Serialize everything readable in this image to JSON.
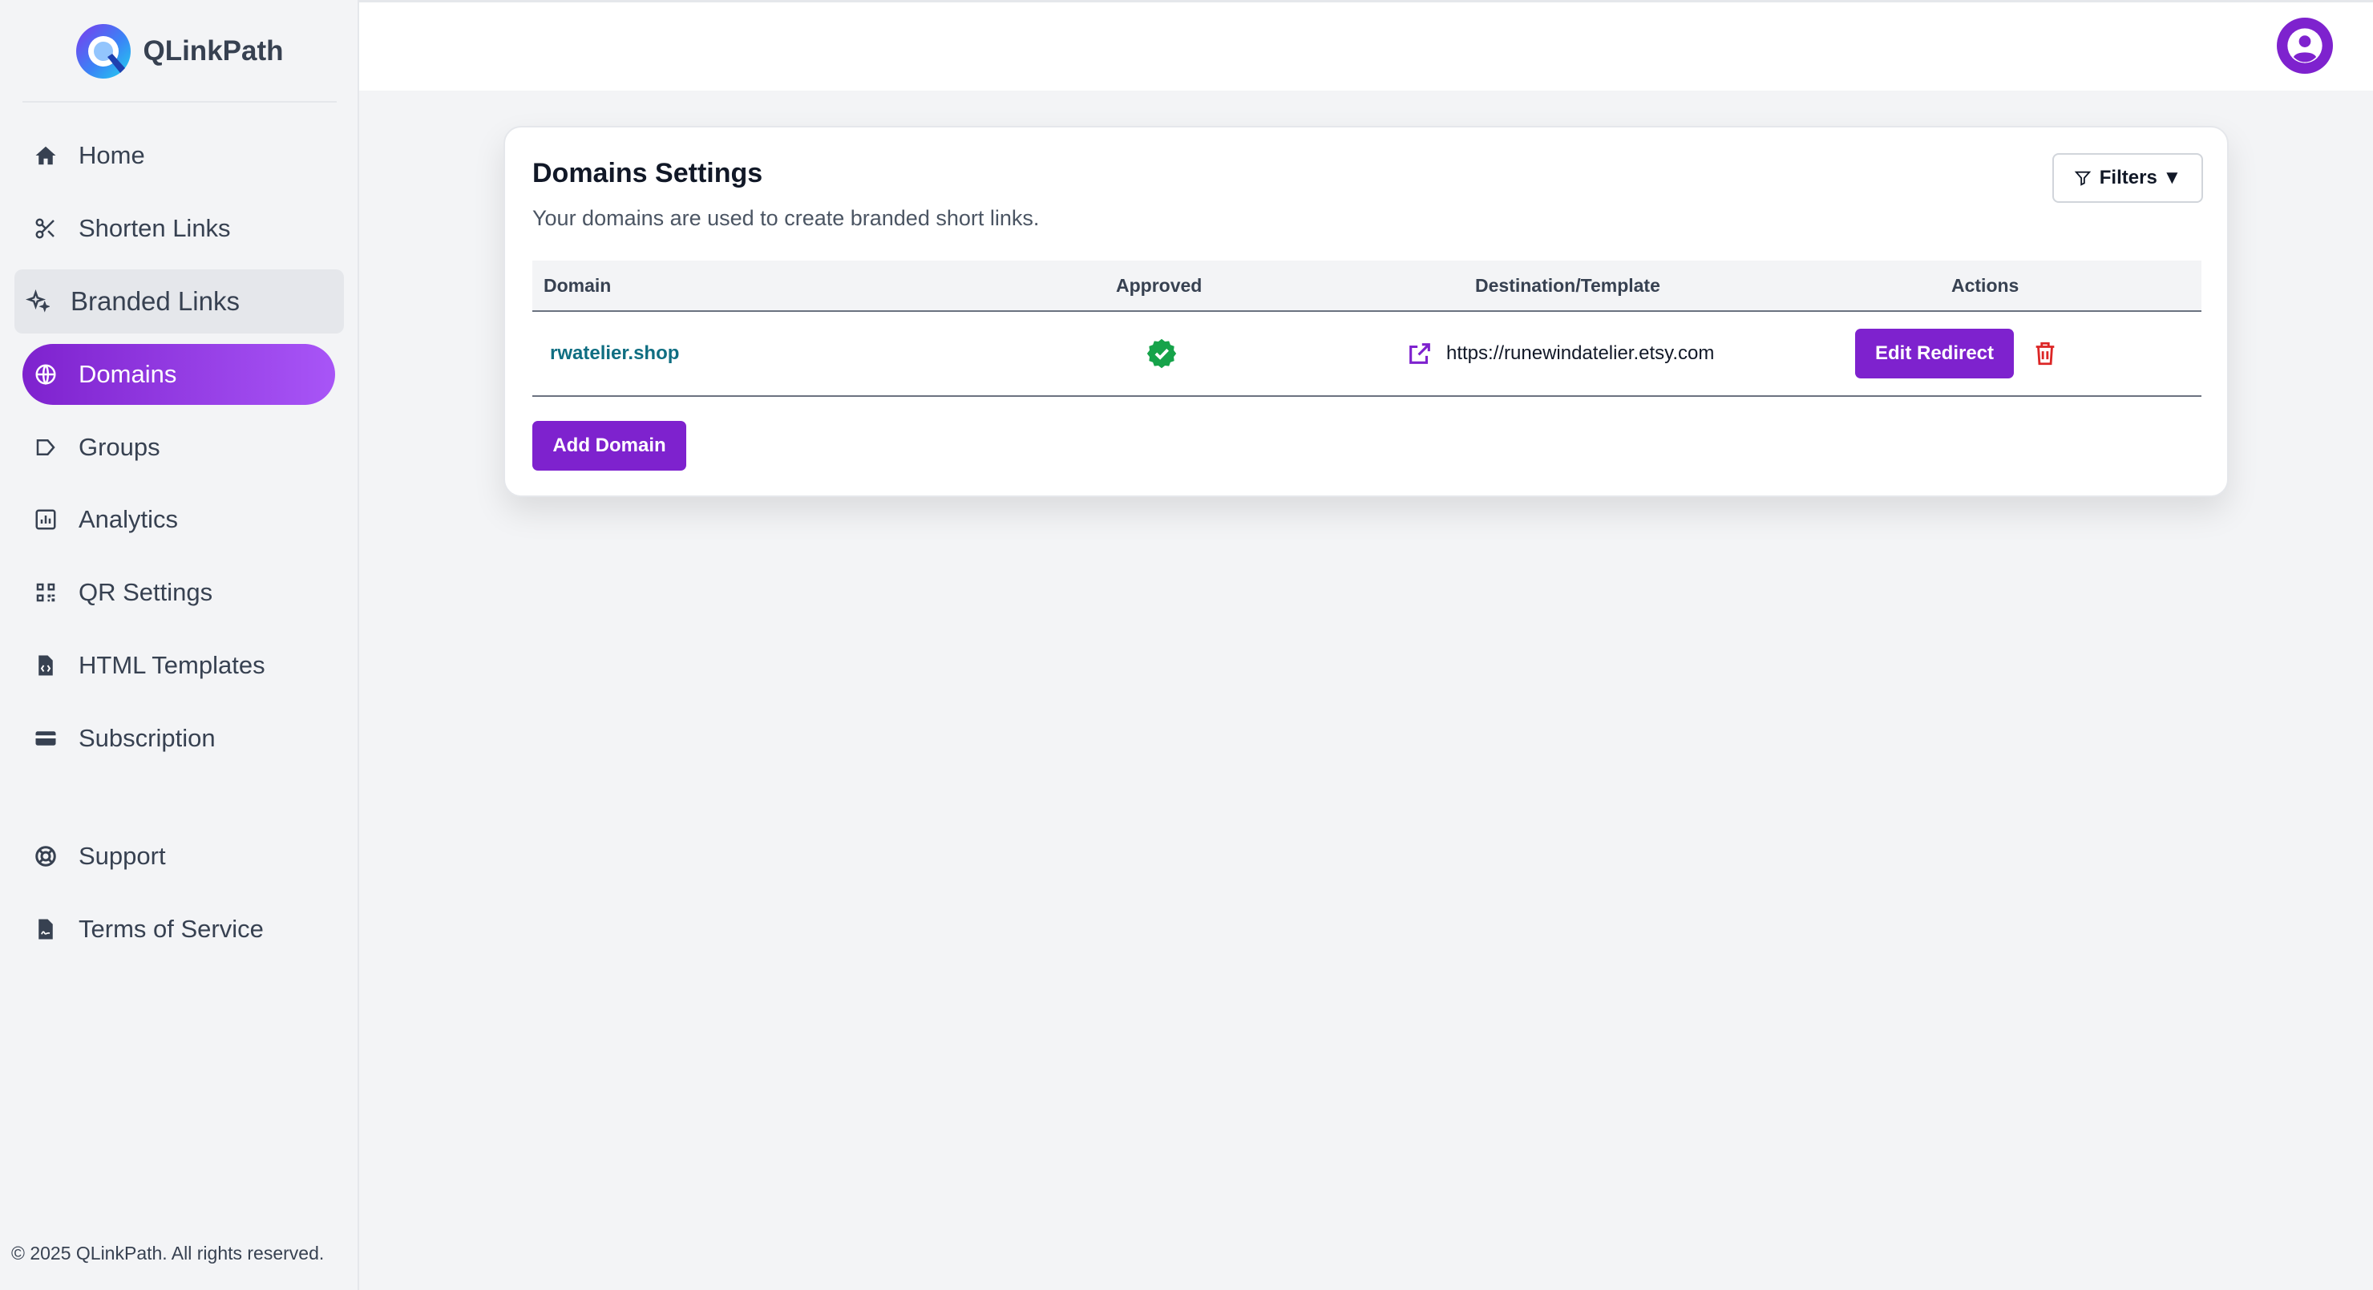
{
  "app": {
    "name": "QLinkPath"
  },
  "sidebar": {
    "items": [
      {
        "label": "Home",
        "icon": "home-icon"
      },
      {
        "label": "Shorten Links",
        "icon": "scissors-icon"
      },
      {
        "label": "Branded Links",
        "icon": "sparkles-icon"
      },
      {
        "label": "Domains",
        "icon": "globe-icon"
      },
      {
        "label": "Groups",
        "icon": "tag-icon"
      },
      {
        "label": "Analytics",
        "icon": "chart-icon"
      },
      {
        "label": "QR Settings",
        "icon": "qrcode-icon"
      },
      {
        "label": "HTML Templates",
        "icon": "file-code-icon"
      },
      {
        "label": "Subscription",
        "icon": "credit-card-icon"
      }
    ],
    "secondary": [
      {
        "label": "Support",
        "icon": "life-ring-icon"
      },
      {
        "label": "Terms of Service",
        "icon": "file-contract-icon"
      }
    ],
    "active": "Domains",
    "hover": "Branded Links",
    "footer": "© 2025 QLinkPath. All rights reserved."
  },
  "page": {
    "title": "Domains Settings",
    "subtitle": "Your domains are used to create branded short links.",
    "filters_label": "Filters ▼",
    "add_domain_label": "Add Domain"
  },
  "table": {
    "columns": [
      "Domain",
      "Approved",
      "Destination/Template",
      "Actions"
    ],
    "rows": [
      {
        "domain": "rwatelier.shop",
        "approved": true,
        "destination": "https://runewindatelier.etsy.com",
        "edit_label": "Edit Redirect"
      }
    ]
  },
  "colors": {
    "accent": "#7e22ce",
    "approved": "#16a34a",
    "delete": "#dc2626",
    "domain_link": "#0f6e82"
  }
}
